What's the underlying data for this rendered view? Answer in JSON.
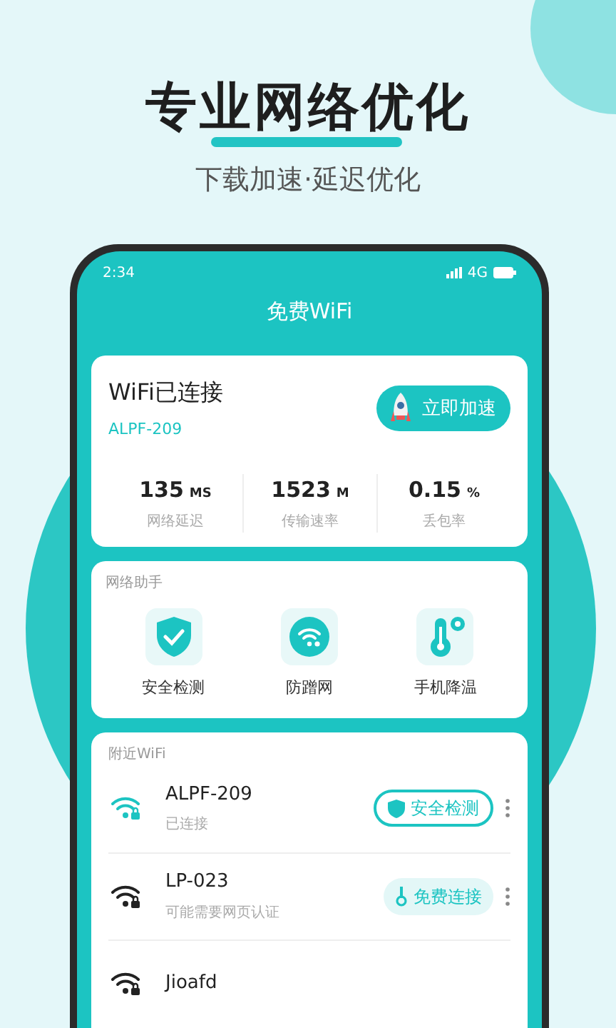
{
  "headline": "专业网络优化",
  "subheadline": "下载加速·延迟优化",
  "status_bar": {
    "time": "2:34",
    "network": "4G"
  },
  "app_title": "免费WiFi",
  "connection": {
    "status": "WiFi已连接",
    "ssid": "ALPF-209",
    "button": "立即加速",
    "stats": [
      {
        "value": "135",
        "unit": "MS",
        "label": "网络延迟"
      },
      {
        "value": "1523",
        "unit": "M",
        "label": "传输速率"
      },
      {
        "value": "0.15",
        "unit": "%",
        "label": "丢包率"
      }
    ]
  },
  "assistant": {
    "title": "网络助手",
    "tools": [
      {
        "kind": "shield",
        "label": "安全检测"
      },
      {
        "kind": "wifi",
        "label": "防蹭网"
      },
      {
        "kind": "thermometer",
        "label": "手机降温"
      }
    ]
  },
  "nearby": {
    "title": "附近WiFi",
    "networks": [
      {
        "name": "ALPF-209",
        "status": "已连接",
        "connected": true,
        "action": {
          "kind": "check",
          "label": "安全检测"
        }
      },
      {
        "name": "LP-023",
        "status": "可能需要网页认证",
        "connected": false,
        "action": {
          "kind": "key",
          "label": "免费连接"
        }
      },
      {
        "name": "Jioafd",
        "connected": false
      }
    ]
  }
}
